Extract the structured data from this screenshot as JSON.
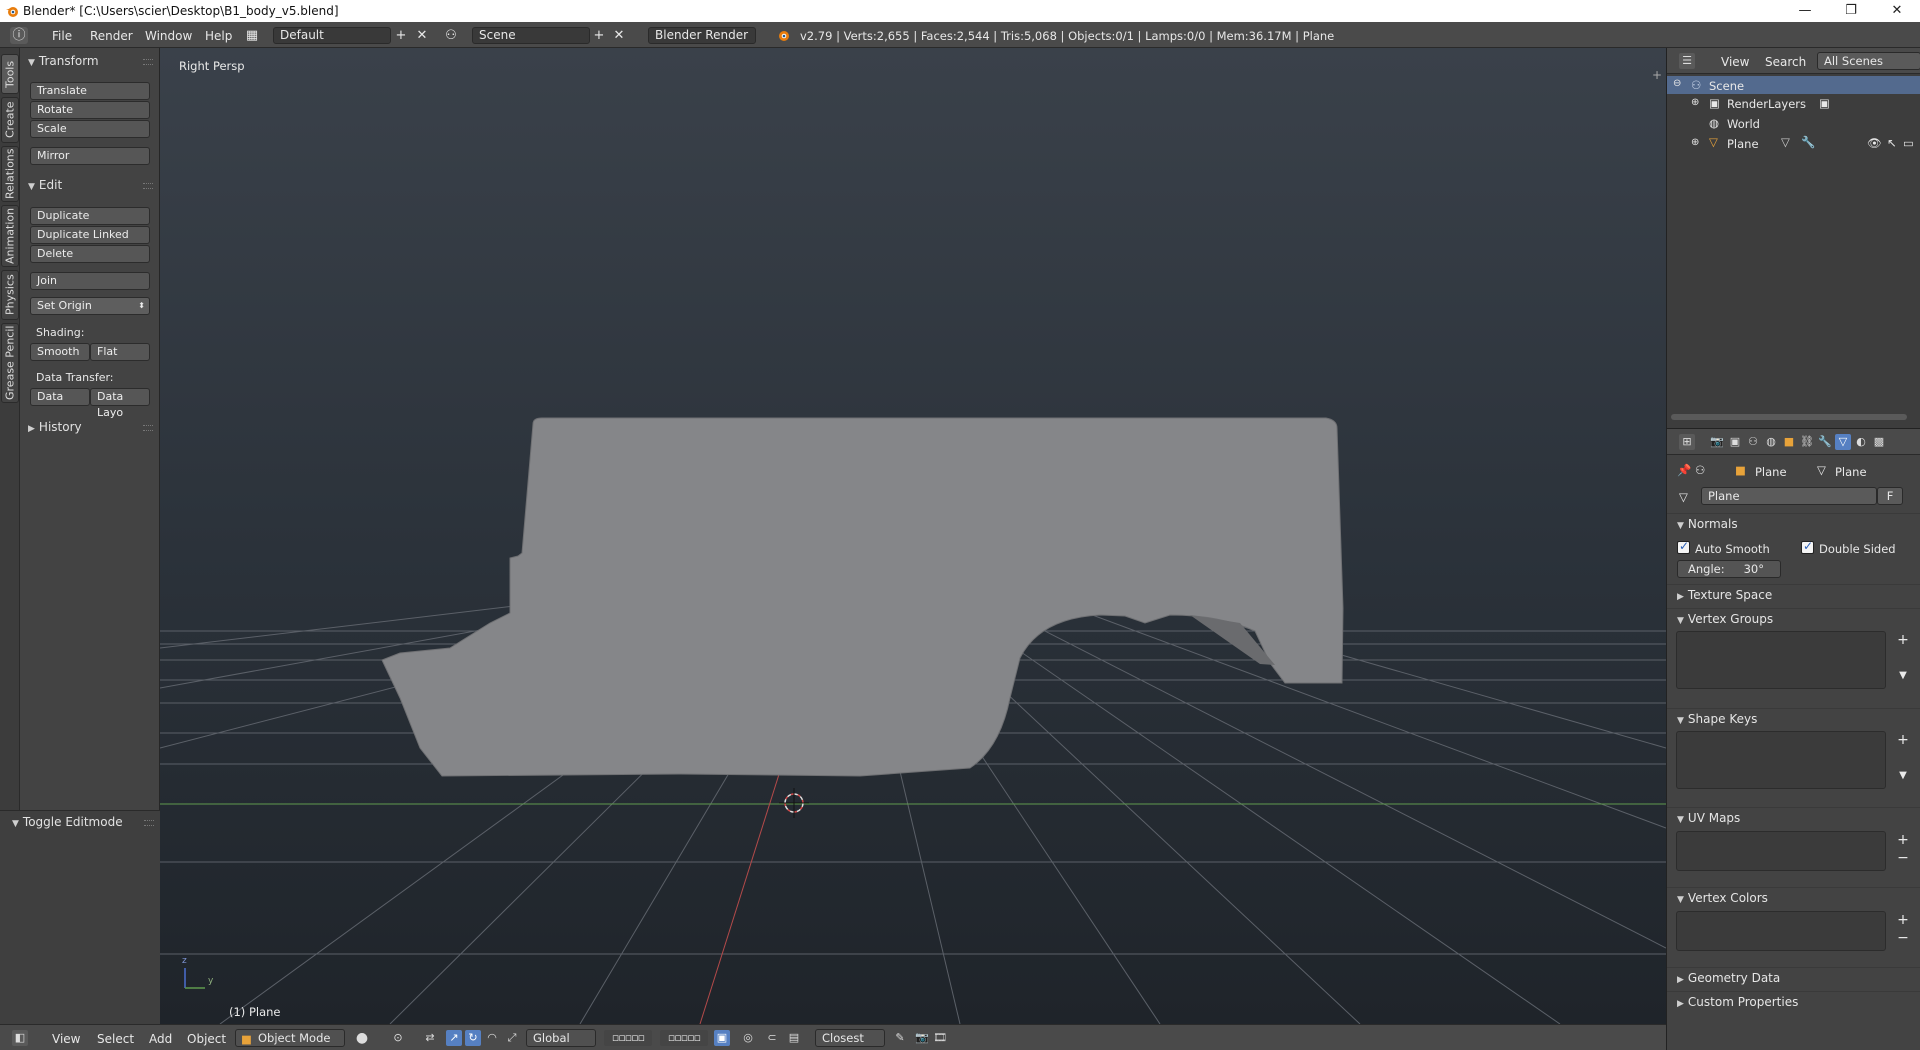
{
  "window": {
    "title": "Blender* [C:\\Users\\scier\\Desktop\\B1_body_v5.blend]",
    "minimize": "—",
    "maximize": "❐",
    "close": "✕"
  },
  "info_header": {
    "menus": [
      "File",
      "Render",
      "Window",
      "Help"
    ],
    "screen_layout": "Default",
    "scene": "Scene",
    "render_engine": "Blender Render",
    "stats": "v2.79 | Verts:2,655 | Faces:2,544 | Tris:5,068 | Objects:0/1 | Lamps:0/0 | Mem:36.17M | Plane"
  },
  "tool_tabs": [
    "Tools",
    "Create",
    "Relations",
    "Animation",
    "Physics",
    "Grease Pencil"
  ],
  "tool_shelf": {
    "transform_header": "Transform",
    "translate": "Translate",
    "rotate": "Rotate",
    "scale": "Scale",
    "mirror": "Mirror",
    "edit_header": "Edit",
    "duplicate": "Duplicate",
    "duplicate_linked": "Duplicate Linked",
    "delete": "Delete",
    "join": "Join",
    "set_origin": "Set Origin",
    "shading_label": "Shading:",
    "smooth": "Smooth",
    "flat": "Flat",
    "data_transfer_label": "Data Transfer:",
    "data": "Data",
    "data_layout": "Data Layo",
    "history_header": "History"
  },
  "operator_panel": {
    "title": "Toggle Editmode"
  },
  "viewport": {
    "view_label": "Right Persp",
    "object_label": "(1) Plane",
    "axis_y": "y",
    "axis_z": "z"
  },
  "bottom_header": {
    "menus": [
      "View",
      "Select",
      "Add",
      "Object"
    ],
    "mode": "Object Mode",
    "orientation": "Global",
    "snap_element": "Closest"
  },
  "outliner": {
    "view": "View",
    "search": "Search",
    "display_mode": "All Scenes",
    "tree": [
      "Scene",
      "RenderLayers",
      "World",
      "Plane"
    ]
  },
  "properties": {
    "object_crumb": "Plane",
    "data_crumb": "Plane",
    "datablock_name": "Plane",
    "fake_user": "F",
    "normals_header": "Normals",
    "auto_smooth": "Auto Smooth",
    "double_sided": "Double Sided",
    "angle_label": "Angle:",
    "angle_value": "30°",
    "texture_space": "Texture Space",
    "vertex_groups": "Vertex Groups",
    "shape_keys": "Shape Keys",
    "uv_maps": "UV Maps",
    "vertex_colors": "Vertex Colors",
    "geometry_data": "Geometry Data",
    "custom_properties": "Custom Properties"
  },
  "colors": {
    "selection_blue": "#5680c2",
    "object_mesh_gray": "#858689",
    "x_axis_red": "#b34a4a",
    "y_axis_green": "#5f9a4e"
  }
}
